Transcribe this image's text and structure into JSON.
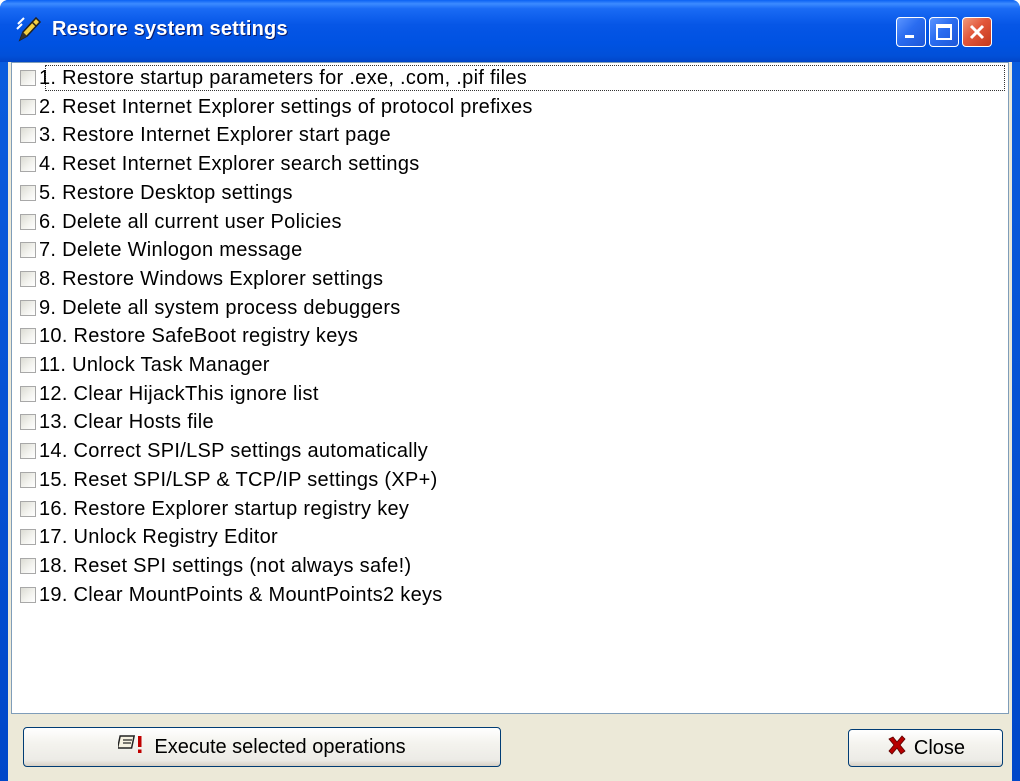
{
  "window": {
    "title": "Restore system settings",
    "icon": "pencil-icon"
  },
  "caption_buttons": {
    "minimize": "minimize-icon",
    "maximize": "maximize-icon",
    "close": "close-icon"
  },
  "items": [
    {
      "label": "1. Restore startup parameters for .exe, .com, .pif files",
      "checked": false
    },
    {
      "label": "2. Reset Internet Explorer settings of protocol prefixes",
      "checked": false
    },
    {
      "label": "3. Restore Internet Explorer start page",
      "checked": false
    },
    {
      "label": "4. Reset Internet Explorer search settings",
      "checked": false
    },
    {
      "label": "5. Restore Desktop settings",
      "checked": false
    },
    {
      "label": "6. Delete all current user Policies",
      "checked": false
    },
    {
      "label": "7. Delete Winlogon message",
      "checked": false
    },
    {
      "label": "8. Restore Windows Explorer settings",
      "checked": false
    },
    {
      "label": "9. Delete all system process debuggers",
      "checked": false
    },
    {
      "label": "10. Restore SafeBoot registry keys",
      "checked": false
    },
    {
      "label": "11. Unlock Task Manager",
      "checked": false
    },
    {
      "label": "12. Clear HijackThis ignore list",
      "checked": false
    },
    {
      "label": "13. Clear Hosts file",
      "checked": false
    },
    {
      "label": "14. Correct SPI/LSP settings automatically",
      "checked": false
    },
    {
      "label": "15. Reset SPI/LSP & TCP/IP settings (XP+)",
      "checked": false
    },
    {
      "label": "16. Restore Explorer startup registry key",
      "checked": false
    },
    {
      "label": "17. Unlock Registry Editor",
      "checked": false
    },
    {
      "label": "18. Reset SPI settings (not always safe!)",
      "checked": false
    },
    {
      "label": "19. Clear MountPoints & MountPoints2 keys",
      "checked": false
    }
  ],
  "buttons": {
    "execute_label": "Execute selected operations",
    "execute_icon": "execute-icon",
    "close_label": "Close",
    "close_icon": "red-x-icon"
  },
  "colors": {
    "titlebar": "#0052e2",
    "dialog_bg": "#ece9d8",
    "close_button": "#e2563a"
  }
}
